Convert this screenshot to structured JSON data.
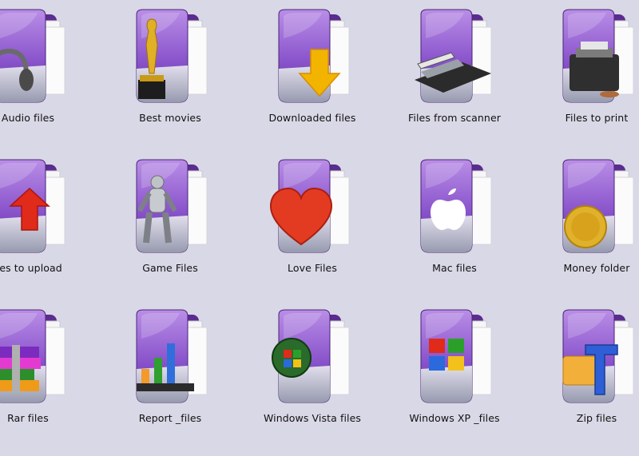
{
  "items": [
    {
      "label": "Audio files",
      "icon": "headphones-icon"
    },
    {
      "label": "Best movies",
      "icon": "oscar-statue-icon"
    },
    {
      "label": "Downloaded files",
      "icon": "download-arrow-icon"
    },
    {
      "label": "Files from scanner",
      "icon": "scanner-icon"
    },
    {
      "label": "Files to print",
      "icon": "printer-icon"
    },
    {
      "label": "iles to upload",
      "icon": "upload-arrow-icon"
    },
    {
      "label": "Game Files",
      "icon": "robot-icon"
    },
    {
      "label": "Love Files",
      "icon": "heart-icon"
    },
    {
      "label": "Mac files",
      "icon": "apple-logo-icon"
    },
    {
      "label": "Money folder",
      "icon": "euro-coin-icon"
    },
    {
      "label": "Rar files",
      "icon": "books-stack-icon"
    },
    {
      "label": "Report _files",
      "icon": "bar-chart-icon"
    },
    {
      "label": "Windows Vista files",
      "icon": "windows-vista-orb-icon"
    },
    {
      "label": "Windows XP _files",
      "icon": "windows-flag-icon"
    },
    {
      "label": "Zip files",
      "icon": "zip-clamp-icon"
    }
  ]
}
